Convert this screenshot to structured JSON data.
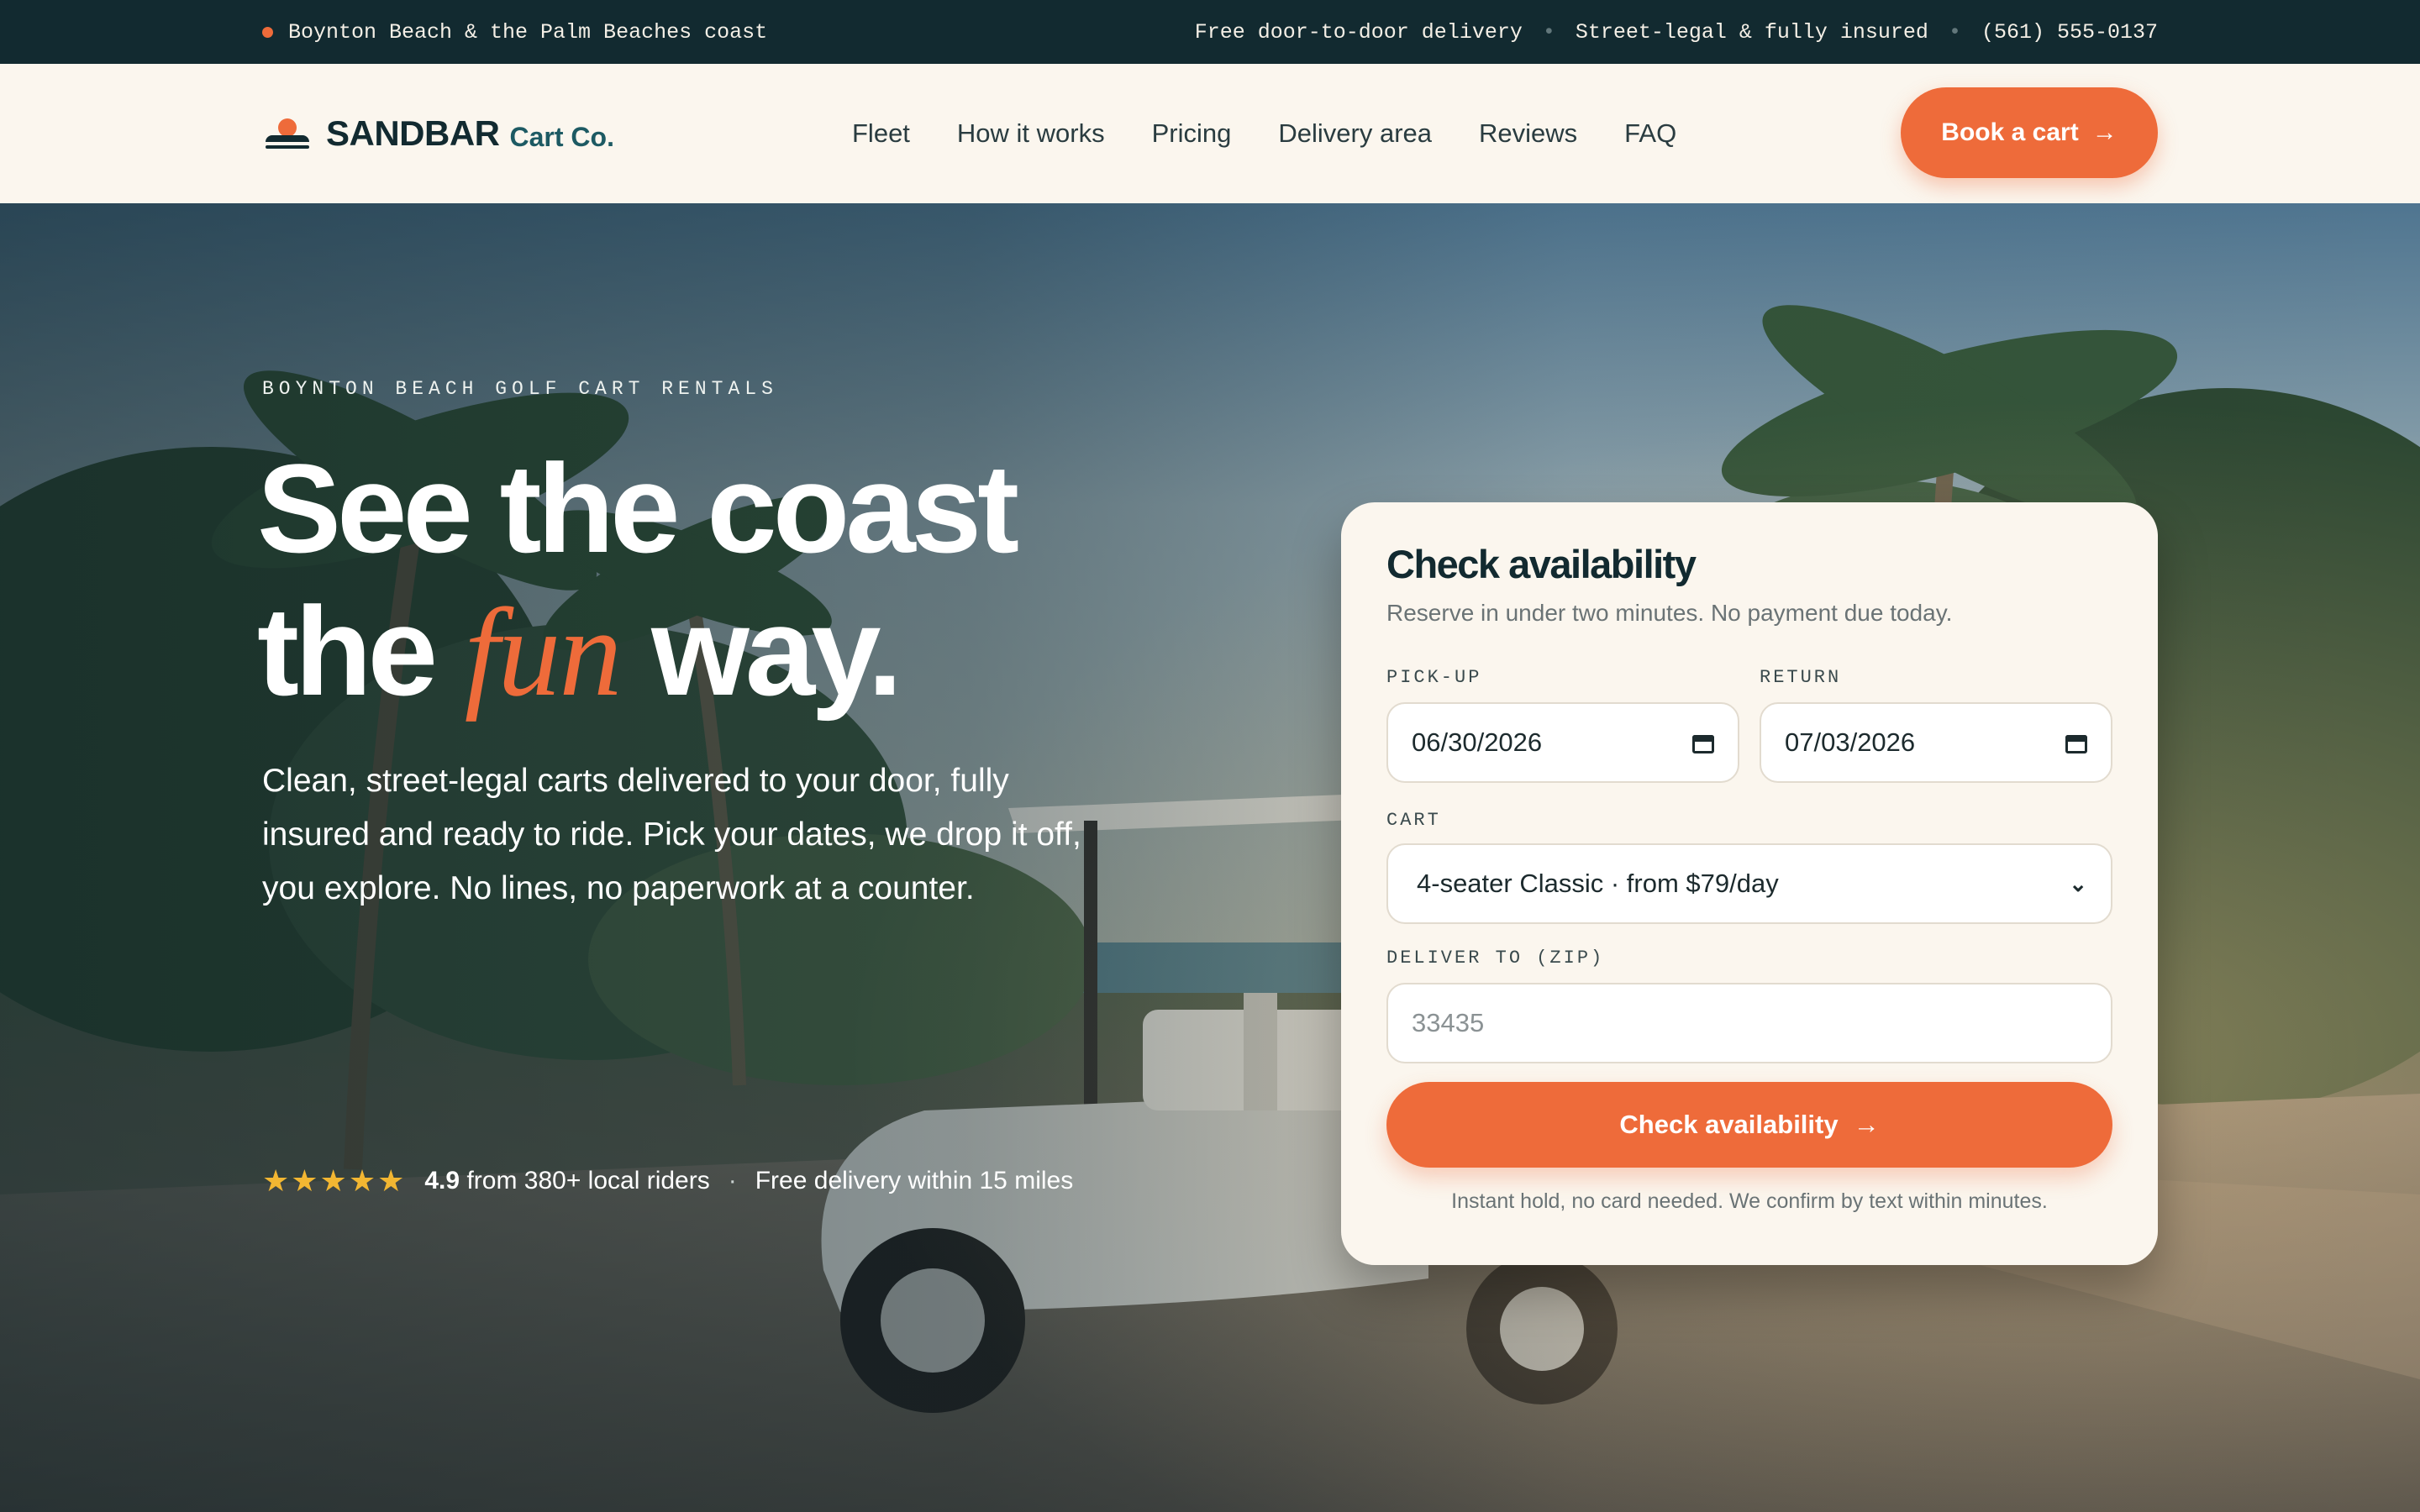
{
  "topbar": {
    "location": "Boynton Beach & the Palm Beaches coast",
    "items": [
      "Free door-to-door delivery",
      "Street-legal & fully insured",
      "(561) 555-0137"
    ],
    "separator": "•"
  },
  "brand": {
    "name": "SANDBAR",
    "suffix": "Cart Co."
  },
  "nav": [
    "Fleet",
    "How it works",
    "Pricing",
    "Delivery area",
    "Reviews",
    "FAQ"
  ],
  "header": {
    "cta_label": "Book a cart",
    "cta_arrow": "→"
  },
  "hero": {
    "eyebrow": "BOYNTON BEACH GOLF CART RENTALS",
    "headline_line1": "See the coast",
    "headline_the": "the",
    "headline_fun": "fun",
    "headline_end": "way.",
    "lede": "Clean, street-legal carts delivered to your door, fully insured and ready to ride. Pick your dates, we drop it off, you explore. No lines, no paperwork at a counter.",
    "stars": "★★★★★",
    "rating_value": "4.9",
    "rating_text": "from 380+ local riders",
    "proof_separator": "·",
    "delivery_note": "Free delivery within 15 miles"
  },
  "booking": {
    "title": "Check availability",
    "description": "Reserve in under two minutes. No payment due today.",
    "pickup_label": "PICK-UP",
    "pickup_value": "06/30/2026",
    "return_label": "RETURN",
    "return_value": "07/03/2026",
    "cart_label": "CART",
    "cart_selected": "4-seater Classic · from $79/day",
    "zip_label": "DELIVER TO (ZIP)",
    "zip_placeholder": "33435",
    "submit_label": "Check availability",
    "submit_arrow": "→",
    "note": "Instant hold, no card needed. We confirm by text within minutes."
  },
  "colors": {
    "accent": "#ee6b3a",
    "navy": "#122a30",
    "cream": "#fbf6ee",
    "star": "#f2b632"
  }
}
